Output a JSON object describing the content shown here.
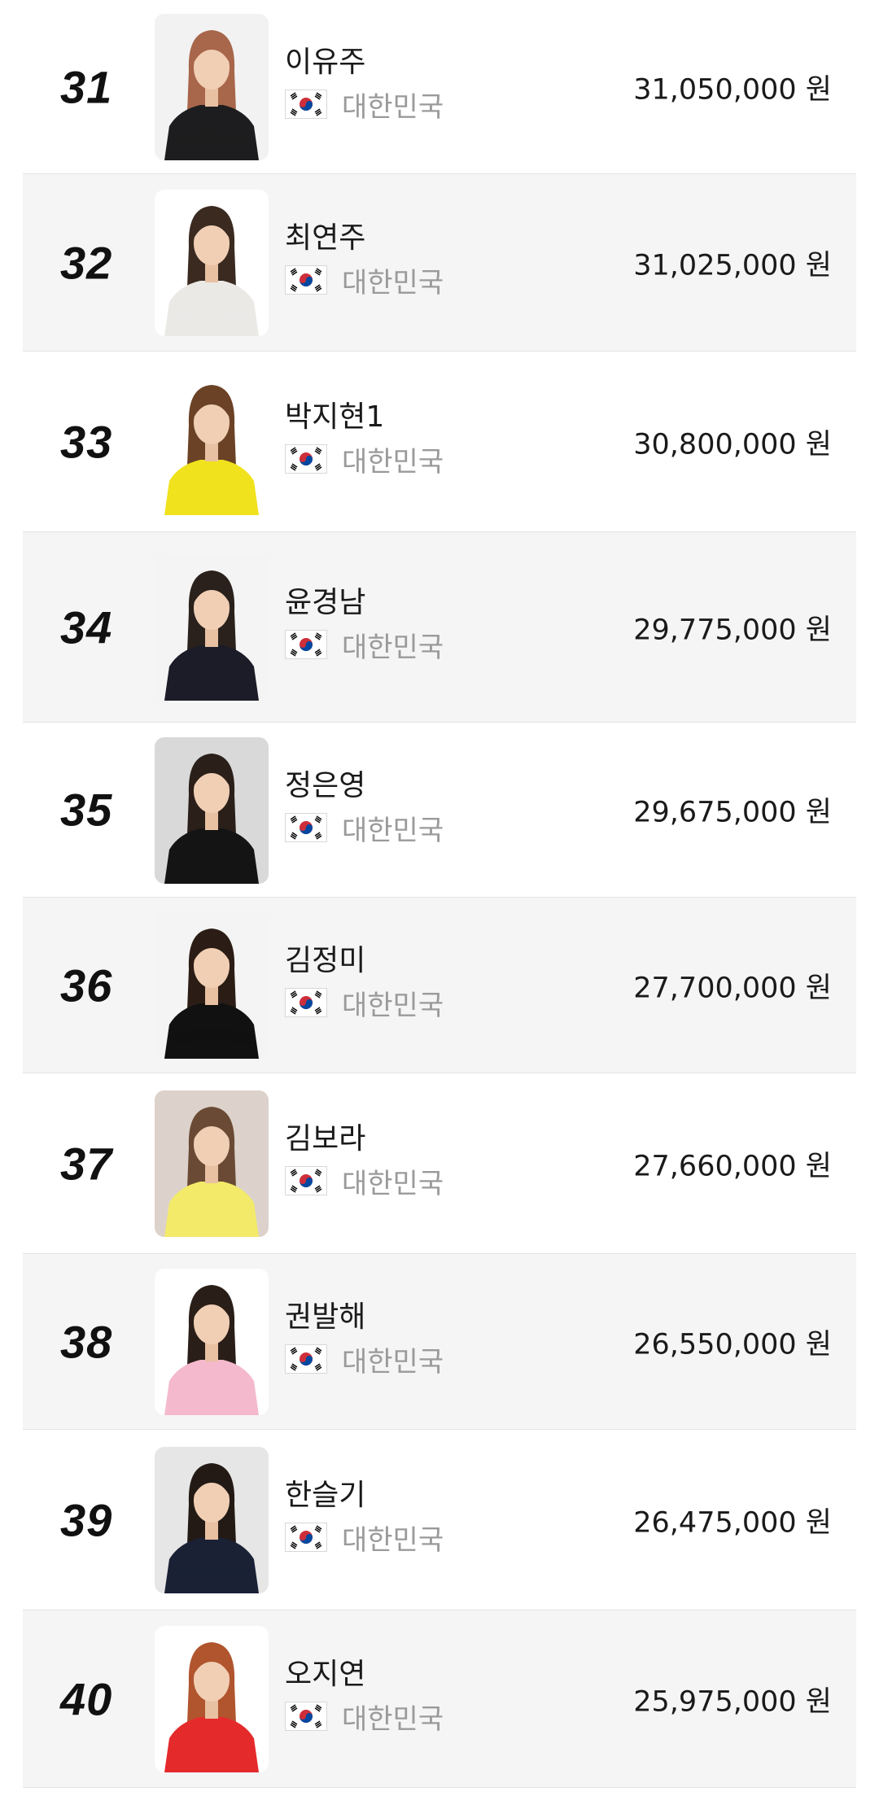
{
  "ranking": {
    "players": [
      {
        "rank": "31",
        "name": "이유주",
        "country": "대한민국",
        "prize": "31,050,000 원",
        "shirt": "#1d1d1f",
        "hair": "#a8664a",
        "photo_bg": "#f2f2f2"
      },
      {
        "rank": "32",
        "name": "최연주",
        "country": "대한민국",
        "prize": "31,025,000 원",
        "shirt": "#ebe9e6",
        "hair": "#3a2a20",
        "photo_bg": "#ffffff"
      },
      {
        "rank": "33",
        "name": "박지현1",
        "country": "대한민국",
        "prize": "30,800,000 원",
        "shirt": "#f0e21c",
        "hair": "#6b4226",
        "photo_bg": "#ffffff"
      },
      {
        "rank": "34",
        "name": "윤경남",
        "country": "대한민국",
        "prize": "29,775,000 원",
        "shirt": "#1b1c28",
        "hair": "#2a211c",
        "photo_bg": "#f4f4f4"
      },
      {
        "rank": "35",
        "name": "정은영",
        "country": "대한민국",
        "prize": "29,675,000 원",
        "shirt": "#141414",
        "hair": "#2a1f19",
        "photo_bg": "#d9d9d9"
      },
      {
        "rank": "36",
        "name": "김정미",
        "country": "대한민국",
        "prize": "27,700,000 원",
        "shirt": "#111111",
        "hair": "#2b1d15",
        "photo_bg": "#f4f4f4"
      },
      {
        "rank": "37",
        "name": "김보라",
        "country": "대한민국",
        "prize": "27,660,000 원",
        "shirt": "#f3ea6a",
        "hair": "#6a4a34",
        "photo_bg": "#dcd2cb"
      },
      {
        "rank": "38",
        "name": "권발해",
        "country": "대한민국",
        "prize": "26,550,000 원",
        "shirt": "#f4b9cc",
        "hair": "#2a1e18",
        "photo_bg": "#ffffff"
      },
      {
        "rank": "39",
        "name": "한슬기",
        "country": "대한민국",
        "prize": "26,475,000 원",
        "shirt": "#1a2135",
        "hair": "#231a15",
        "photo_bg": "#e6e6e6"
      },
      {
        "rank": "40",
        "name": "오지연",
        "country": "대한민국",
        "prize": "25,975,000 원",
        "shirt": "#e52a2c",
        "hair": "#b0552e",
        "photo_bg": "#ffffff"
      }
    ]
  },
  "icons": {
    "flag": "south-korea-flag-icon"
  }
}
